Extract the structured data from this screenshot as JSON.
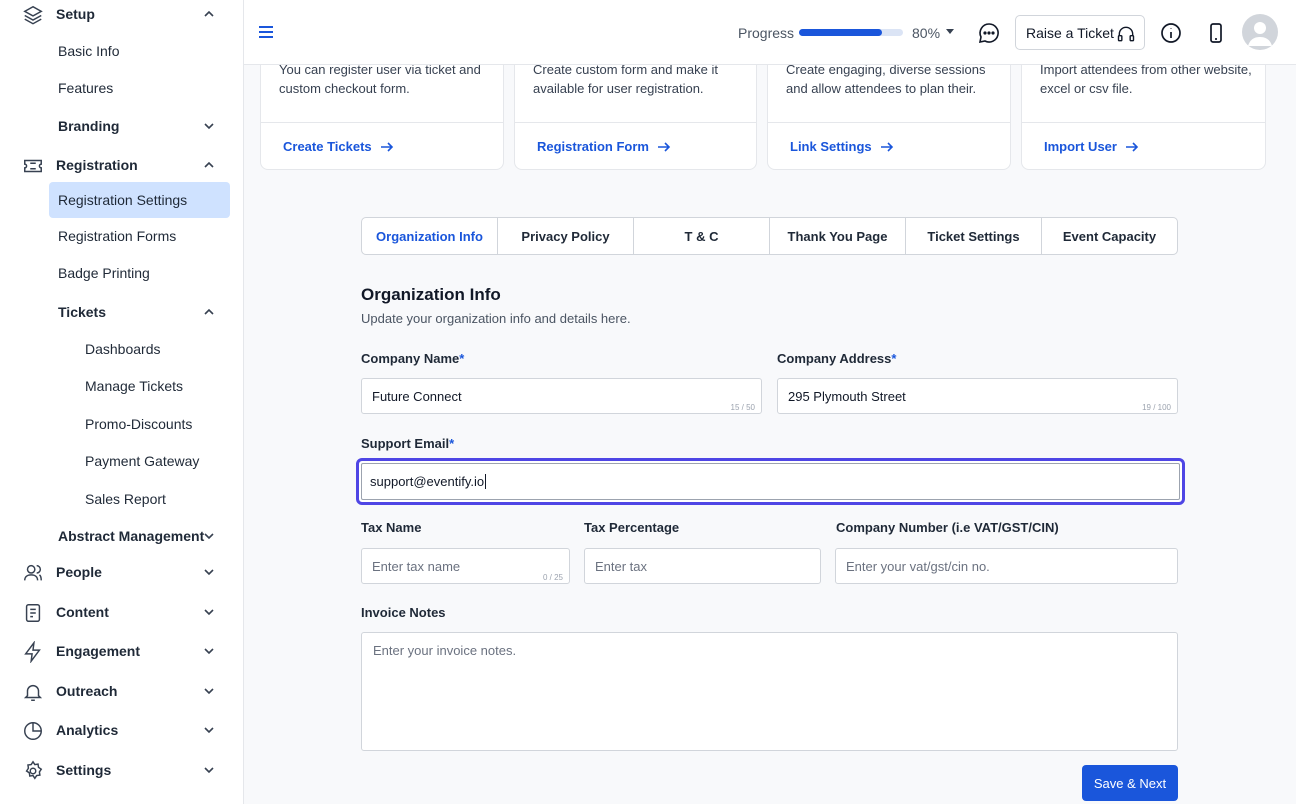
{
  "sidebar": {
    "setup": "Setup",
    "basic_info": "Basic Info",
    "features": "Features",
    "branding": "Branding",
    "registration": "Registration",
    "registration_settings": "Registration Settings",
    "registration_forms": "Registration Forms",
    "badge_printing": "Badge Printing",
    "tickets": "Tickets",
    "dashboards": "Dashboards",
    "manage_tickets": "Manage Tickets",
    "promo_discounts": "Promo-Discounts",
    "payment_gateway": "Payment Gateway",
    "sales_report": "Sales Report",
    "abstract_management": "Abstract Management",
    "people": "People",
    "content": "Content",
    "engagement": "Engagement",
    "outreach": "Outreach",
    "analytics": "Analytics",
    "settings": "Settings"
  },
  "header": {
    "progress_label": "Progress",
    "progress_value": 0.8,
    "progress_text": "80%",
    "raise_ticket": "Raise a Ticket"
  },
  "cards": [
    {
      "desc": "You can register user via ticket and custom checkout form.",
      "link": "Create Tickets"
    },
    {
      "desc": "Create custom form and make it available for user registration.",
      "link": "Registration Form"
    },
    {
      "desc": "Create engaging, diverse sessions and allow attendees to plan their.",
      "link": "Link Settings"
    },
    {
      "desc": "Import attendees from other website, excel or csv file.",
      "link": "Import User"
    }
  ],
  "tabs": [
    "Organization Info",
    "Privacy Policy",
    "T & C",
    "Thank You Page",
    "Ticket Settings",
    "Event Capacity"
  ],
  "form": {
    "title": "Organization Info",
    "subtitle": "Update your organization info and details here.",
    "company_name_label": "Company Name",
    "company_name_value": "Future Connect",
    "company_name_count": "15 / 50",
    "company_address_label": "Company Address",
    "company_address_value": "295 Plymouth Street",
    "company_address_count": "19 / 100",
    "support_email_label": "Support Email",
    "support_email_value": "support@eventify.io",
    "required_mark": "*",
    "tax_name_label": "Tax Name",
    "tax_name_placeholder": "Enter tax name",
    "tax_name_count": "0 / 25",
    "tax_pct_label": "Tax Percentage",
    "tax_pct_placeholder": "Enter tax",
    "company_number_label": "Company Number (i.e VAT/GST/CIN)",
    "company_number_placeholder": "Enter your vat/gst/cin no.",
    "invoice_notes_label": "Invoice Notes",
    "invoice_notes_placeholder": "Enter your invoice notes.",
    "save_next": "Save & Next"
  }
}
